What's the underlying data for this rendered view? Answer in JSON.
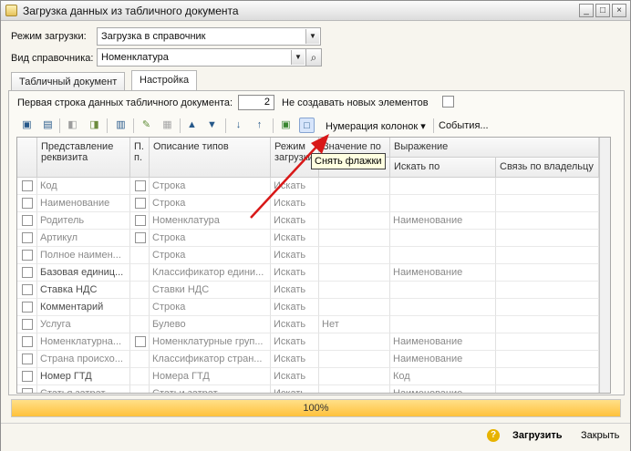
{
  "window": {
    "title": "Загрузка данных из табличного документа"
  },
  "form": {
    "load_mode_label": "Режим загрузки:",
    "load_mode_value": "Загрузка в справочник",
    "catalog_type_label": "Вид справочника:",
    "catalog_type_value": "Номенклатура"
  },
  "tabs": [
    {
      "label": "Табличный документ"
    },
    {
      "label": "Настройка"
    }
  ],
  "settings": {
    "first_row_label": "Первая строка данных табличного документа:",
    "first_row_value": "2",
    "no_new_label": "Не создавать новых элементов"
  },
  "toolbar": {
    "numbering_label": "Нумерация колонок",
    "events_label": "События..."
  },
  "tooltip": {
    "text": "Снять флажки"
  },
  "table": {
    "headers": {
      "attr": "Представление реквизита",
      "p": "П. п.",
      "types": "Описание типов",
      "mode": "Режим загрузки",
      "value": "Значение по",
      "expr": "Выражение",
      "search_by": "Искать по",
      "owner_link": "Связь по владельцу"
    },
    "rows": [
      {
        "attr": "Код",
        "p": true,
        "type": "Строка",
        "mode": "Искать",
        "value": "",
        "search": ""
      },
      {
        "attr": "Наименование",
        "p": true,
        "type": "Строка",
        "mode": "Искать",
        "value": "",
        "search": ""
      },
      {
        "attr": "Родитель",
        "p": true,
        "type": "Номенклатура",
        "mode": "Искать",
        "value": "",
        "search": "Наименование"
      },
      {
        "attr": "Артикул",
        "p": true,
        "type": "Строка",
        "mode": "Искать",
        "value": "",
        "search": ""
      },
      {
        "attr": "Полное наимен...",
        "p": false,
        "type": "Строка",
        "mode": "Искать",
        "value": "",
        "search": ""
      },
      {
        "attr": "Базовая единиц...",
        "p": false,
        "type": "Классификатор едини...",
        "mode": "Искать",
        "value": "",
        "search": "Наименование"
      },
      {
        "attr": "Ставка НДС",
        "p": false,
        "type": "Ставки НДС",
        "mode": "Искать",
        "value": "",
        "search": ""
      },
      {
        "attr": "Комментарий",
        "p": false,
        "type": "Строка",
        "mode": "Искать",
        "value": "",
        "search": ""
      },
      {
        "attr": "Услуга",
        "p": false,
        "type": "Булево",
        "mode": "Искать",
        "value": "Нет",
        "search": ""
      },
      {
        "attr": "Номенклатурна...",
        "p": true,
        "type": "Номенклатурные груп...",
        "mode": "Искать",
        "value": "",
        "search": "Наименование"
      },
      {
        "attr": "Страна происхо...",
        "p": false,
        "type": "Классификатор стран...",
        "mode": "Искать",
        "value": "",
        "search": "Наименование"
      },
      {
        "attr": "Номер ГТД",
        "p": false,
        "type": "Номера ГТД",
        "mode": "Искать",
        "value": "",
        "search": "Код"
      },
      {
        "attr": "Статья затрат",
        "p": false,
        "type": "Статьи затрат",
        "mode": "Искать",
        "value": "",
        "search": "Наименование"
      }
    ]
  },
  "progress": {
    "value": "100%"
  },
  "buttons": {
    "load": "Загрузить",
    "close": "Закрыть"
  },
  "icons": [
    "app-icon",
    "minimize-icon",
    "maximize-icon",
    "close-icon",
    "search-icon",
    "open-file-icon",
    "save-icon",
    "move-left-icon",
    "move-right-icon",
    "settings-icon",
    "edit-icon",
    "lock-icon",
    "up-arrow-icon",
    "down-arrow-icon",
    "sort-asc-icon",
    "sort-desc-icon",
    "check-all-icon",
    "uncheck-all-icon",
    "help-icon"
  ]
}
